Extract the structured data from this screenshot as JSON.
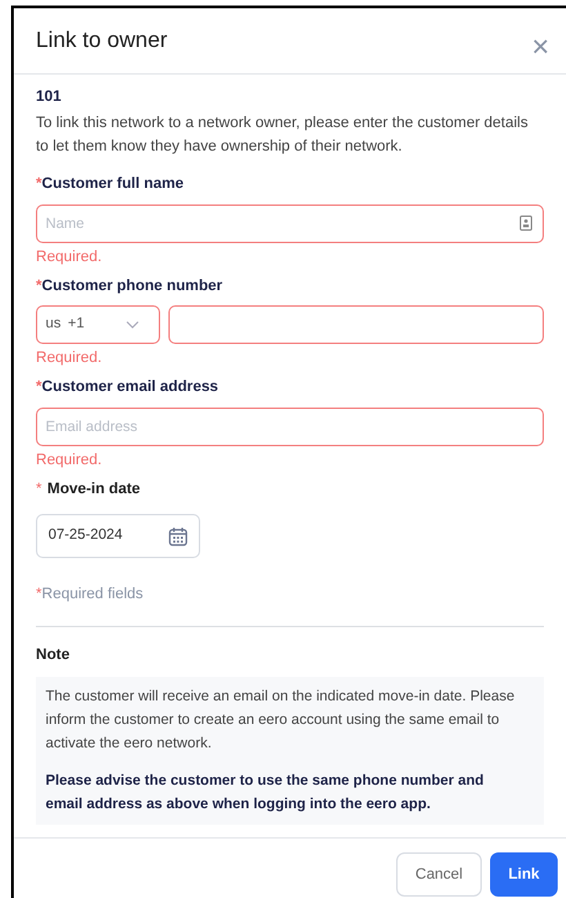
{
  "dialog": {
    "title": "Link to owner",
    "close": "×"
  },
  "network_name": "101",
  "intro": "To link this network to a network owner, please enter the customer details to let them know they have ownership of their network.",
  "fields": [
    {
      "kind": "text",
      "required_mark": "*",
      "label": "Customer full name",
      "placeholder": "Name",
      "invalid": true,
      "error": "Required."
    },
    {
      "kind": "phone",
      "required_mark": "*",
      "label": "Customer phone number",
      "country": "us",
      "code": "+1",
      "invalid": true,
      "error": "Required."
    },
    {
      "kind": "text",
      "required_mark": "*",
      "label": "Customer email address",
      "placeholder": "Email address",
      "invalid": true,
      "error": "Required."
    },
    {
      "kind": "date",
      "required_mark": "*",
      "label": "Move-in date",
      "value": "07-25-2024",
      "invalid": false
    }
  ],
  "required_note": {
    "mark": "*",
    "text": "Required fields"
  },
  "note": {
    "title": "Note",
    "body": "The customer will receive an email on the indicated move-in date. Please inform the customer to create an eero account using the same email to activate the eero network.",
    "emphasis": "Please advise the customer to use the same phone number and email address as above when logging into the eero app."
  },
  "buttons": [
    {
      "label": "Cancel",
      "kind": "secondary"
    },
    {
      "label": "Link",
      "kind": "primary"
    }
  ]
}
